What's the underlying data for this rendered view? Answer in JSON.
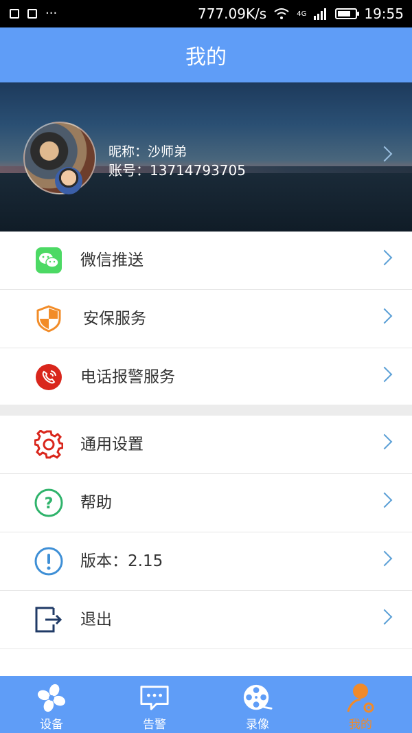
{
  "status_bar": {
    "speed": "777.09K/s",
    "network": "4G",
    "time": "19:55",
    "more": "···"
  },
  "header": {
    "title": "我的"
  },
  "profile": {
    "nickname": "昵称：沙师弟",
    "account": "账号：13714793705"
  },
  "menu_group_1": [
    {
      "label": "微信推送",
      "icon": "wechat-icon",
      "color": "#4cd964"
    },
    {
      "label": "安保服务",
      "icon": "shield-icon",
      "color": "#f28c28"
    },
    {
      "label": "电话报警服务",
      "icon": "phone-alarm-icon",
      "color": "#d9261c"
    }
  ],
  "menu_group_2": [
    {
      "label": "通用设置",
      "icon": "gear-icon",
      "color": "#d9261c"
    },
    {
      "label": "帮助",
      "icon": "help-icon",
      "color": "#2fb36b"
    },
    {
      "label": "版本：2.15",
      "icon": "info-icon",
      "color": "#3e8fd6"
    },
    {
      "label": "退出",
      "icon": "logout-icon",
      "color": "#1f3a66"
    }
  ],
  "tabs": [
    {
      "label": "设备",
      "icon": "fan-icon",
      "active": false
    },
    {
      "label": "告警",
      "icon": "chat-icon",
      "active": false
    },
    {
      "label": "录像",
      "icon": "film-reel-icon",
      "active": false
    },
    {
      "label": "我的",
      "icon": "user-icon",
      "active": true
    }
  ],
  "colors": {
    "primary": "#5f9df7",
    "active_tab": "#f08a2a",
    "chevron": "#5a9fd6"
  }
}
